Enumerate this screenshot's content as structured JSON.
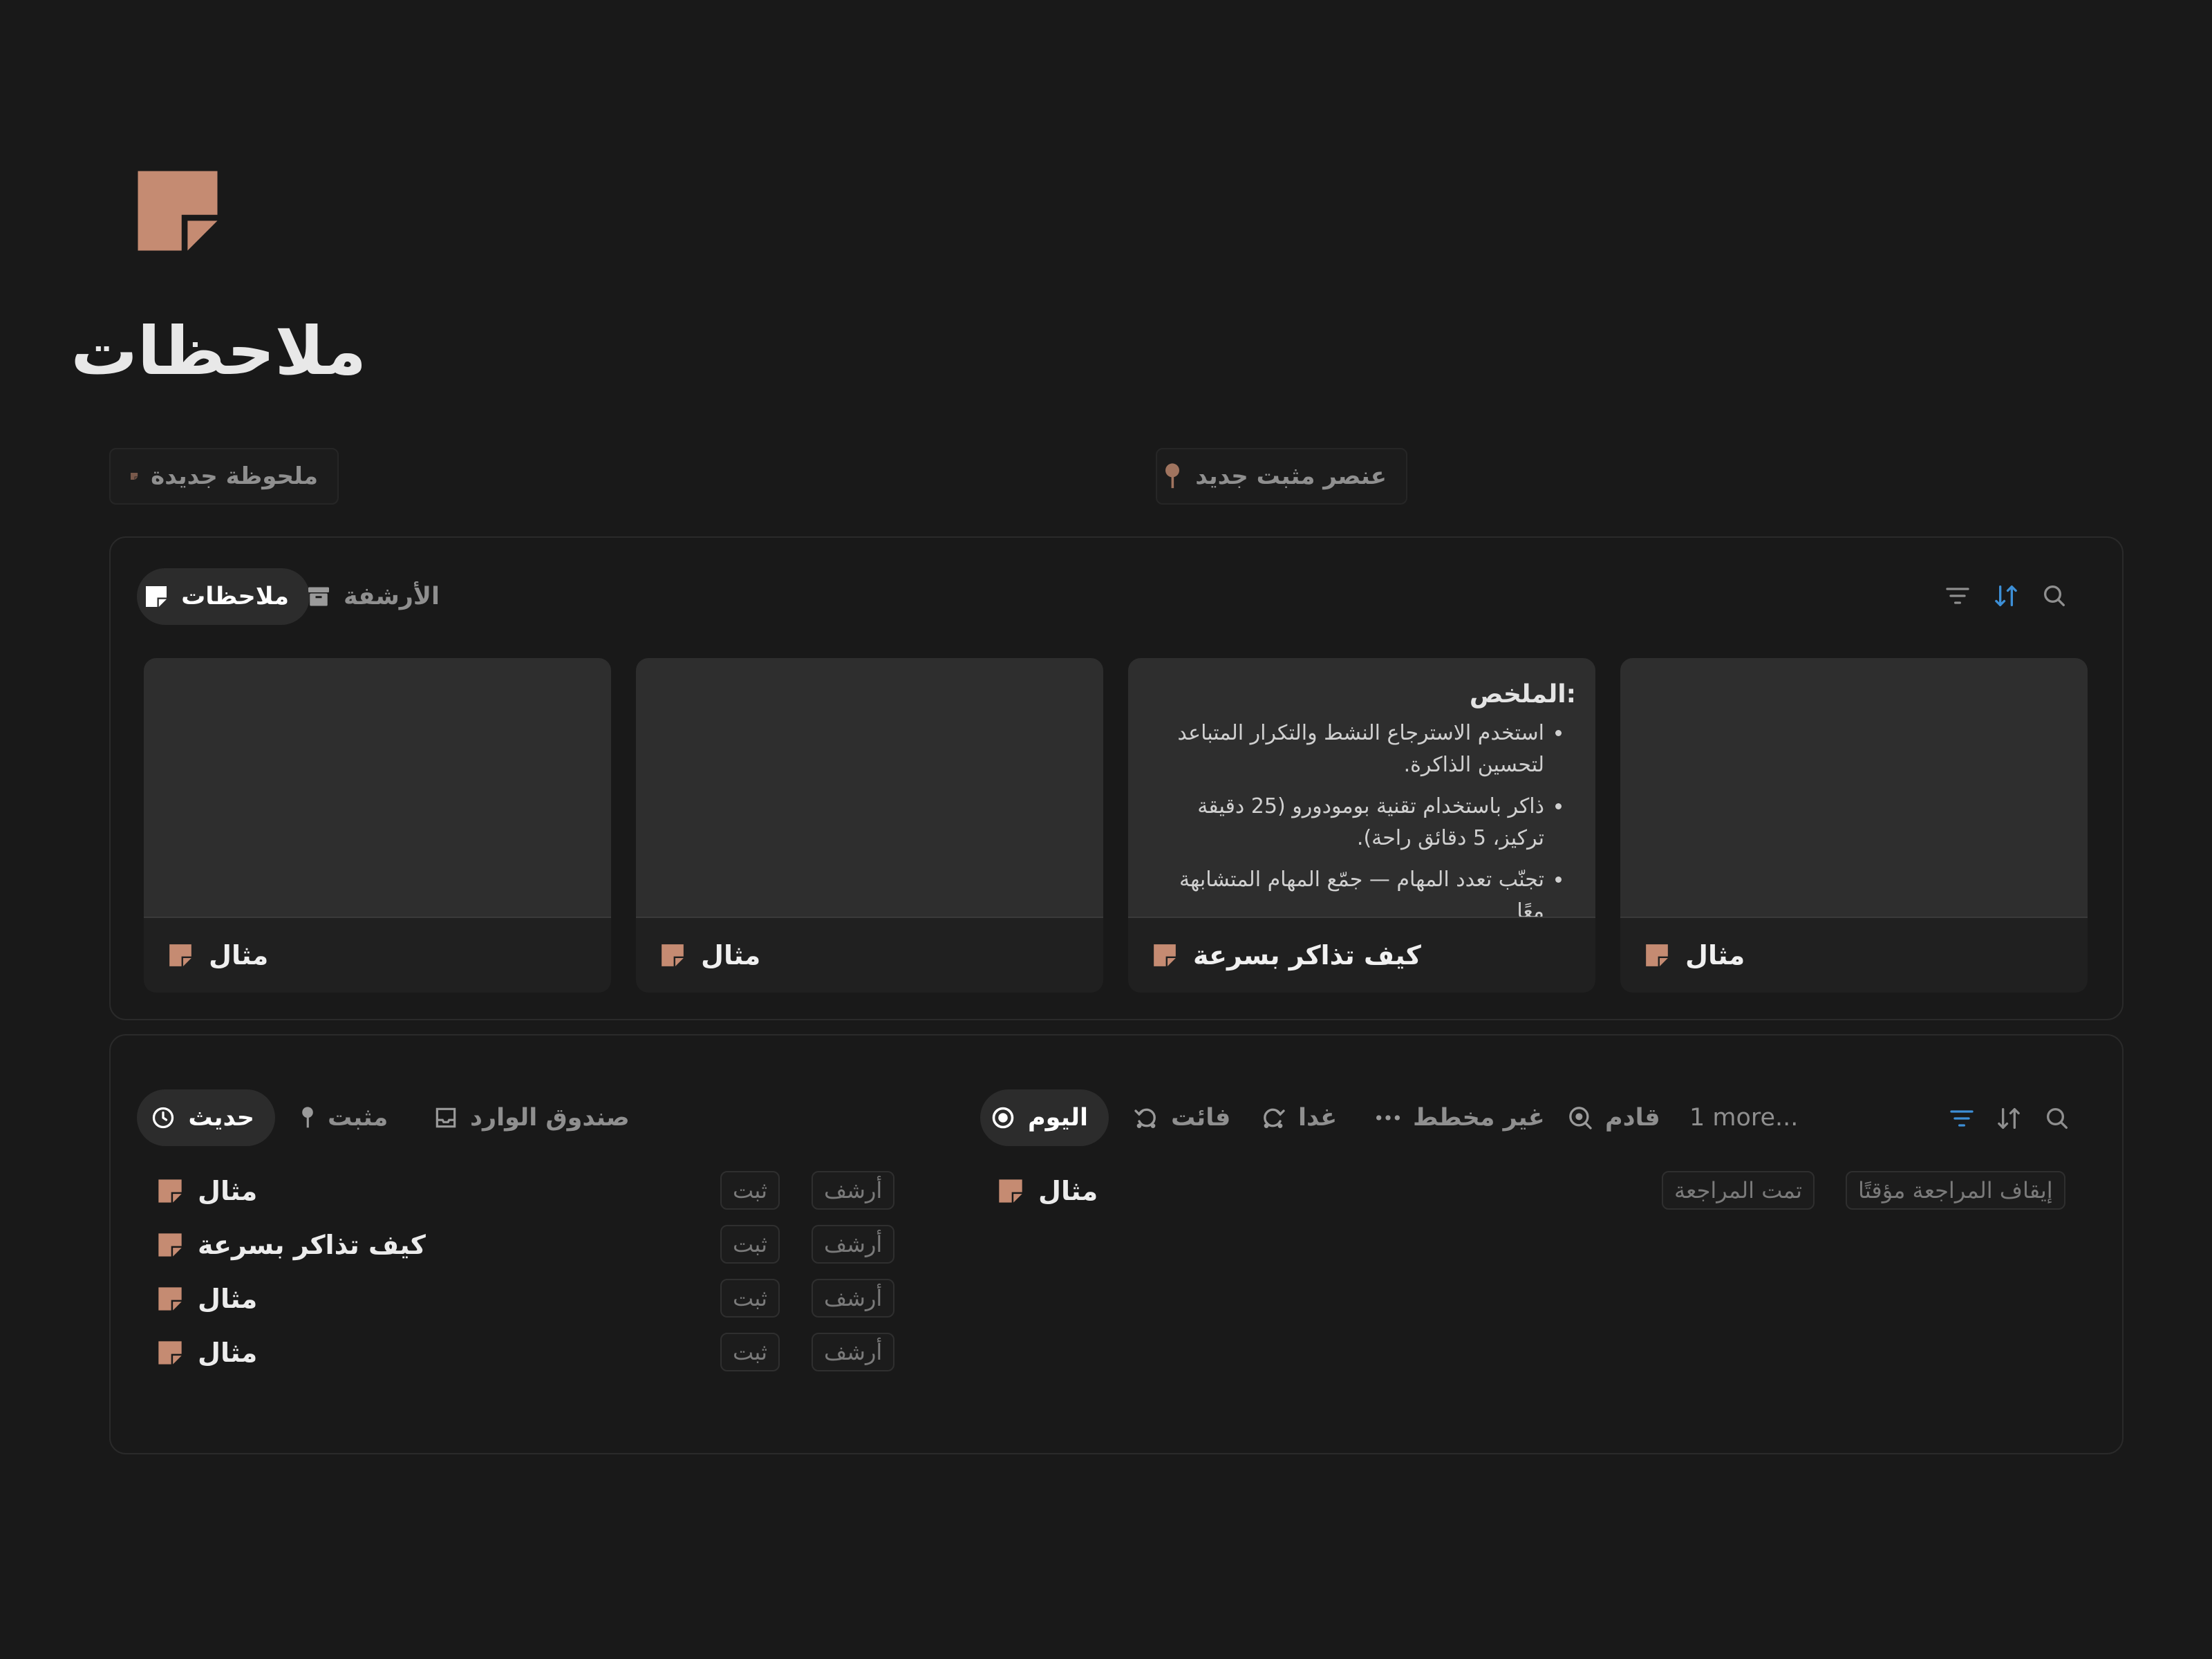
{
  "page": {
    "title": "ملاحظات",
    "new_note_button": "ملحوظة جديدة",
    "new_pinned_button": "عنصر مثبت جديد"
  },
  "gallery": {
    "tabs": [
      {
        "label": "ملاحظات",
        "icon": "note-icon",
        "active": true
      },
      {
        "label": "الأرشفة",
        "icon": "archive-icon",
        "active": false
      }
    ],
    "cards": [
      {
        "title": "مثال",
        "preview": ""
      },
      {
        "title": "مثال",
        "preview": ""
      },
      {
        "title": "كيف تذاكر بسرعة",
        "preview": {
          "heading": ":الملخص",
          "bullets": [
            "استخدم الاسترجاع النشط والتكرار المتباعد لتحسين الذاكرة.",
            "ذاكر باستخدام تقنية بومودورو (25 دقيقة تركيز، 5 دقائق راحة).",
            "تجنّب تعدد المهام — جمّع المهام المتشابهة معًا"
          ]
        }
      },
      {
        "title": "مثال",
        "preview": ""
      }
    ]
  },
  "list": {
    "left_tabs": [
      {
        "label": "حديث",
        "icon": "clock-icon",
        "active": true
      },
      {
        "label": "مثبت",
        "icon": "pin-icon",
        "active": false
      },
      {
        "label": "صندوق الوارد",
        "icon": "inbox-icon",
        "active": false
      }
    ],
    "right_tabs": [
      {
        "label": "اليوم",
        "icon": "target-icon",
        "active": true
      },
      {
        "label": "فائت",
        "icon": "past-icon",
        "active": false
      },
      {
        "label": "غدا",
        "icon": "tomorrow-icon",
        "active": false
      },
      {
        "label": "غير مخطط",
        "icon": "dots-icon",
        "active": false
      },
      {
        "label": "قادم",
        "icon": "upcoming-icon",
        "active": false
      }
    ],
    "more_label": "1 more...",
    "recent_rows": [
      {
        "title": "مثال",
        "pin": "ثبت",
        "archive": "أرشف"
      },
      {
        "title": "كيف تذاكر بسرعة",
        "pin": "ثبت",
        "archive": "أرشف"
      },
      {
        "title": "مثال",
        "pin": "ثبت",
        "archive": "أرشف"
      },
      {
        "title": "مثال",
        "pin": "ثبت",
        "archive": "أرشف"
      }
    ],
    "review_rows": [
      {
        "title": "مثال",
        "reviewed": "تمت المراجعة",
        "pause": "إيقاف المراجعة مؤقتًا"
      }
    ]
  },
  "colors": {
    "accent_note": "#c58b72",
    "accent_blue": "#3d8fd6",
    "background": "#191919"
  }
}
